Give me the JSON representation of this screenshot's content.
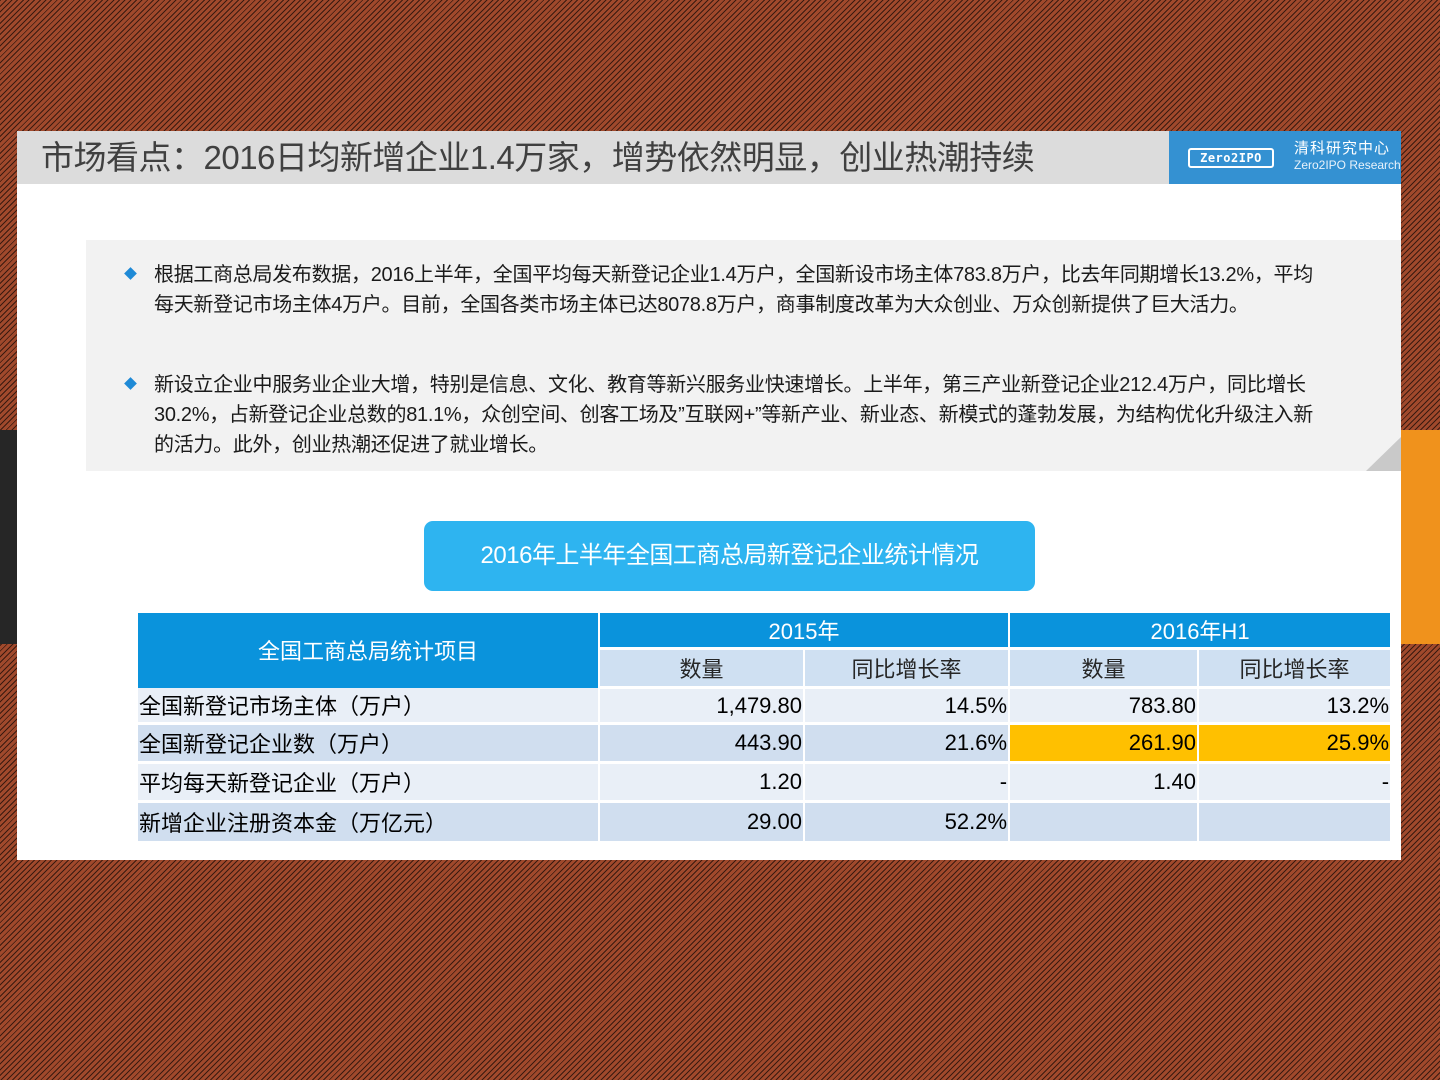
{
  "slide": {
    "title": "市场看点：2016日均新增企业1.4万家，增势依然明显，创业热潮持续",
    "logo": {
      "mark": "Zero2IPO",
      "name_cn": "清科研究中心",
      "name_en": "Zero2IPO Research"
    },
    "bullets": [
      "根据工商总局发布数据，2016上半年，全国平均每天新登记企业1.4万户，全国新设市场主体783.8万户，比去年同期增长13.2%，平均每天新登记市场主体4万户。目前，全国各类市场主体已达8078.8万户，商事制度改革为大众创业、万众创新提供了巨大活力。",
      "新设立企业中服务业企业大增，特别是信息、文化、教育等新兴服务业快速增长。上半年，第三产业新登记企业212.4万户，同比增长30.2%，占新登记企业总数的81.1%，众创空间、创客工场及”互联网+”等新产业、新业态、新模式的蓬勃发展，为结构优化升级注入新的活力。此外，创业热潮还促进了就业增长。"
    ],
    "table_caption": "2016年上半年全国工商总局新登记企业统计情况",
    "colors": {
      "accent_blue": "#0a93dc",
      "caption_blue": "#2eb4f0",
      "highlight": "#ffc000",
      "side_orange": "#f0921c"
    }
  },
  "chart_data": {
    "type": "table",
    "header_main": "全国工商总局统计项目",
    "years": [
      "2015年",
      "2016年H1"
    ],
    "sub_headers": [
      "数量",
      "同比增长率",
      "数量",
      "同比增长率"
    ],
    "rows": [
      {
        "label": "全国新登记市场主体（万户）",
        "cells": [
          "1,479.80",
          "14.5%",
          "783.80",
          "13.2%"
        ]
      },
      {
        "label": "全国新登记企业数（万户）",
        "cells": [
          "443.90",
          "21.6%",
          "261.90",
          "25.9%"
        ],
        "highlighted_columns": [
          2,
          3
        ]
      },
      {
        "label": "平均每天新登记企业（万户）",
        "cells": [
          "1.20",
          "-",
          "1.40",
          "-"
        ]
      },
      {
        "label": "新增企业注册资本金（万亿元）",
        "cells": [
          "29.00",
          "52.2%",
          "",
          ""
        ]
      }
    ]
  }
}
